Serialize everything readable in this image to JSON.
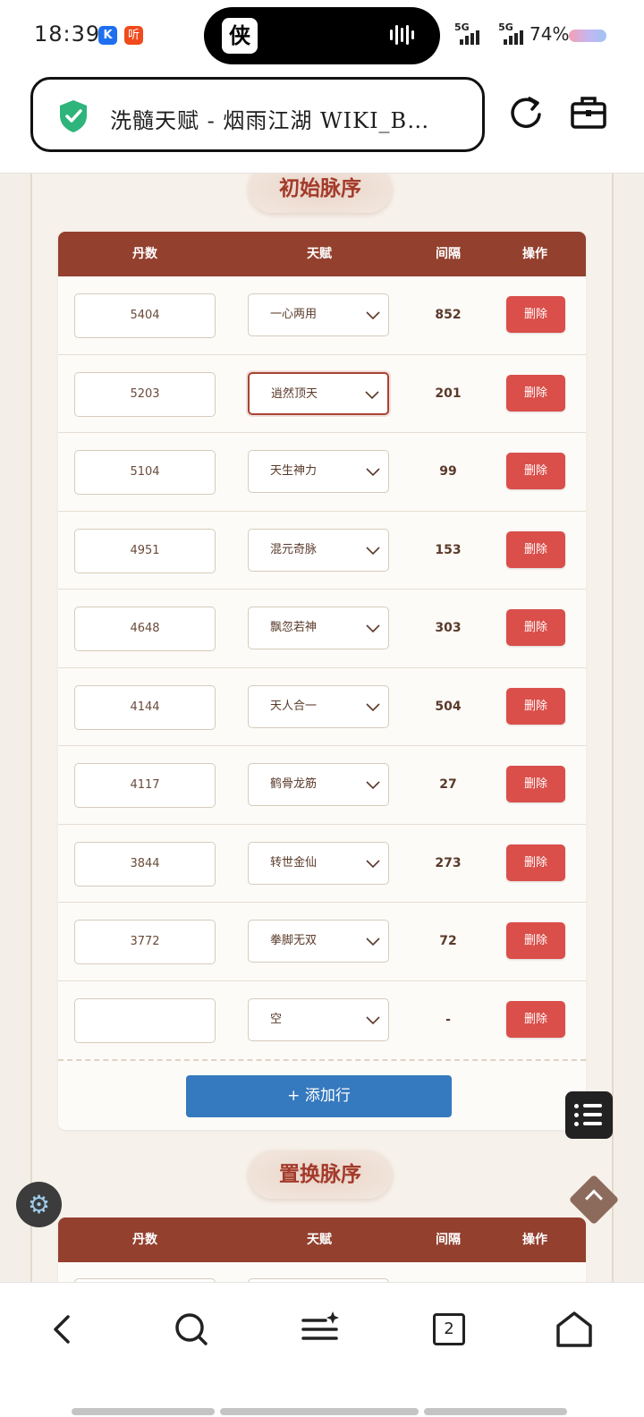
{
  "status_bar": {
    "time": "18:39",
    "app_icon_1": "K",
    "app_icon_2": "听",
    "signal_1": "5G",
    "signal_2": "5G",
    "battery": "74%"
  },
  "browser": {
    "page_title": "洗髓天赋 - 烟雨江湖 WIKI_B…",
    "secure_icon": "shield-check-icon",
    "reload_icon": "reload-icon",
    "toolkit_icon": "toolbox-icon",
    "tab_count": "2"
  },
  "colors": {
    "header_brown": "#93402e",
    "delete_red": "#da4f4a",
    "add_blue": "#3579be",
    "section_title": "#a33a2a"
  },
  "section_initial": {
    "title": "初始脉序",
    "headers": [
      "丹数",
      "天赋",
      "间隔",
      "操作"
    ],
    "rows": [
      {
        "dan": "5404",
        "talent": "一心两用",
        "interval": "852",
        "action": "删除"
      },
      {
        "dan": "5203",
        "talent": "逍然顶天",
        "interval": "201",
        "action": "删除"
      },
      {
        "dan": "5104",
        "talent": "天生神力",
        "interval": "99",
        "action": "删除"
      },
      {
        "dan": "4951",
        "talent": "混元奇脉",
        "interval": "153",
        "action": "删除"
      },
      {
        "dan": "4648",
        "talent": "飘忽若神",
        "interval": "303",
        "action": "删除"
      },
      {
        "dan": "4144",
        "talent": "天人合一",
        "interval": "504",
        "action": "删除"
      },
      {
        "dan": "4117",
        "talent": "鹤骨龙筋",
        "interval": "27",
        "action": "删除"
      },
      {
        "dan": "3844",
        "talent": "转世金仙",
        "interval": "273",
        "action": "删除"
      },
      {
        "dan": "3772",
        "talent": "拳脚无双",
        "interval": "72",
        "action": "删除"
      },
      {
        "dan": "",
        "talent": "空",
        "interval": "-",
        "action": "删除"
      }
    ],
    "add_label": "+ 添加行"
  },
  "section_swap": {
    "title": "置换脉序",
    "headers": [
      "丹数",
      "天赋",
      "间隔",
      "操作"
    ]
  }
}
